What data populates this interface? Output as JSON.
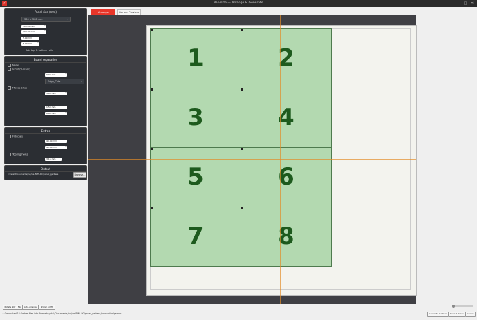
{
  "window": {
    "title": "Panelize — Arrange & Generate",
    "app_icon": "pdf-app-icon"
  },
  "panel_size": {
    "header": "Panel size (mm)",
    "preset": "300 × 300 mm",
    "width": "300.00 mm",
    "height": "300.00 mm",
    "rail_top": "5.00 mm",
    "rail_bottom": "5.00 mm",
    "add_rails_label": "Add top & bottom rails"
  },
  "board_separation": {
    "header": "Board separation",
    "opt_none": "None",
    "opt_vcut": "V-cut (V-score)",
    "vcut_offset": "0.00 mm",
    "layer": "Edge_Cuts",
    "mouse_bites_label": "Mouse bites",
    "mb_size": "3.00 mm",
    "mb_spacing": "1.50 mm",
    "mb_offset": "0.80 mm"
  },
  "extras": {
    "header": "Extras",
    "fiducials_label": "Fiducials",
    "fid_1": "40.00 mm",
    "fid_2": "40.00 mm",
    "tooling_label": "Tooling holes",
    "tooling_value": "3.15 mm"
  },
  "output": {
    "header": "Output",
    "path": "/crystal/Documents/... (path truncated)",
    "path_text": "crystal/Documents/tvt/ws-BMS-RC/panel_gerbers",
    "browse_label": "Browse..."
  },
  "tabs": [
    {
      "label": "Arrange"
    },
    {
      "label": "Gerber Preview"
    }
  ],
  "boards": [
    {
      "label": "1"
    },
    {
      "label": "2"
    },
    {
      "label": "3"
    },
    {
      "label": "4"
    },
    {
      "label": "5"
    },
    {
      "label": "6"
    },
    {
      "label": "7"
    },
    {
      "label": "8"
    }
  ],
  "bottom": {
    "rotate_label": "Rotate 90°",
    "flip_label": "Flip",
    "auto_arrange_label": "Auto-arrange",
    "zoom_label": "Zoom to fit",
    "generate_label": "Generate Gerbers",
    "save_close_label": "Save & Close",
    "cancel_label": "Cancel",
    "status": "✔ Generated 18 Gerber files into /home/crystal/Documents/tvt/ws-BMS-RC/panel_gerbers/production/gerber"
  },
  "colors": {
    "accent": "#e8362a",
    "board_fill": "#b3d9b0",
    "board_number": "#1d5a1d",
    "guide": "#e38b28"
  }
}
